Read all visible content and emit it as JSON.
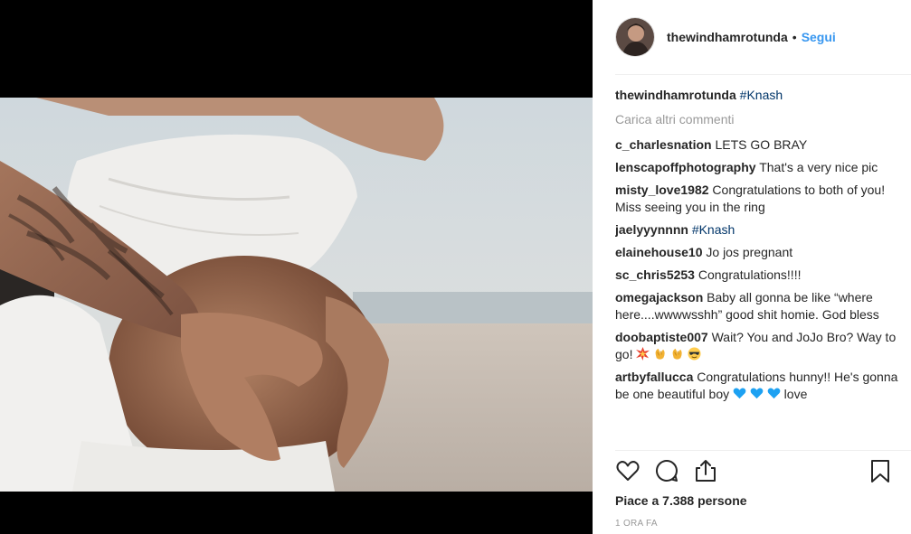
{
  "post": {
    "username": "thewindhamrotunda",
    "separator": "•",
    "follow_label": "Segui",
    "caption": {
      "user": "thewindhamrotunda",
      "hashtag": "#Knash"
    },
    "load_more_label": "Carica altri commenti",
    "comments": [
      {
        "user": "c_charlesnation",
        "text": "LETS GO BRAY"
      },
      {
        "user": "lenscapoffphotography",
        "text": "That's a very nice pic"
      },
      {
        "user": "misty_love1982",
        "text": "Congratulations to both of you! Miss seeing you in the ring"
      },
      {
        "user": "jaelyyynnnn",
        "text": "#Knash"
      },
      {
        "user": "elainehouse10",
        "text": "Jo jos pregnant"
      },
      {
        "user": "sc_chris5253",
        "text": "Congratulations!!!!"
      },
      {
        "user": "omegajackson",
        "text": "Baby all gonna be like “where here....wwwwsshh” good shit homie. God bless"
      },
      {
        "user": "doobaptiste007",
        "text": "Wait? You and JoJo Bro? Way to go!"
      },
      {
        "user": "artbyfallucca",
        "text": "Congratulations hunny!! He's gonna be one beautiful boy",
        "text_after_emojis": "love"
      }
    ],
    "likes_label": "Piace a 7.388 persone",
    "time_label": "1 ORA FA"
  },
  "icons": {
    "like": "heart-icon",
    "comment": "comment-bubble-icon",
    "share": "share-icon",
    "save": "bookmark-icon",
    "doobaptiste_emojis": [
      "collision-emoji",
      "clapping-hands-emoji",
      "clapping-hands-emoji",
      "sunglasses-emoji"
    ],
    "artbyfallucca_emojis": [
      "blue-heart-emoji",
      "blue-heart-emoji",
      "blue-heart-emoji"
    ]
  },
  "colors": {
    "link_blue": "#3897f0",
    "hashtag": "#003569",
    "muted": "#999999",
    "text": "#262626"
  }
}
